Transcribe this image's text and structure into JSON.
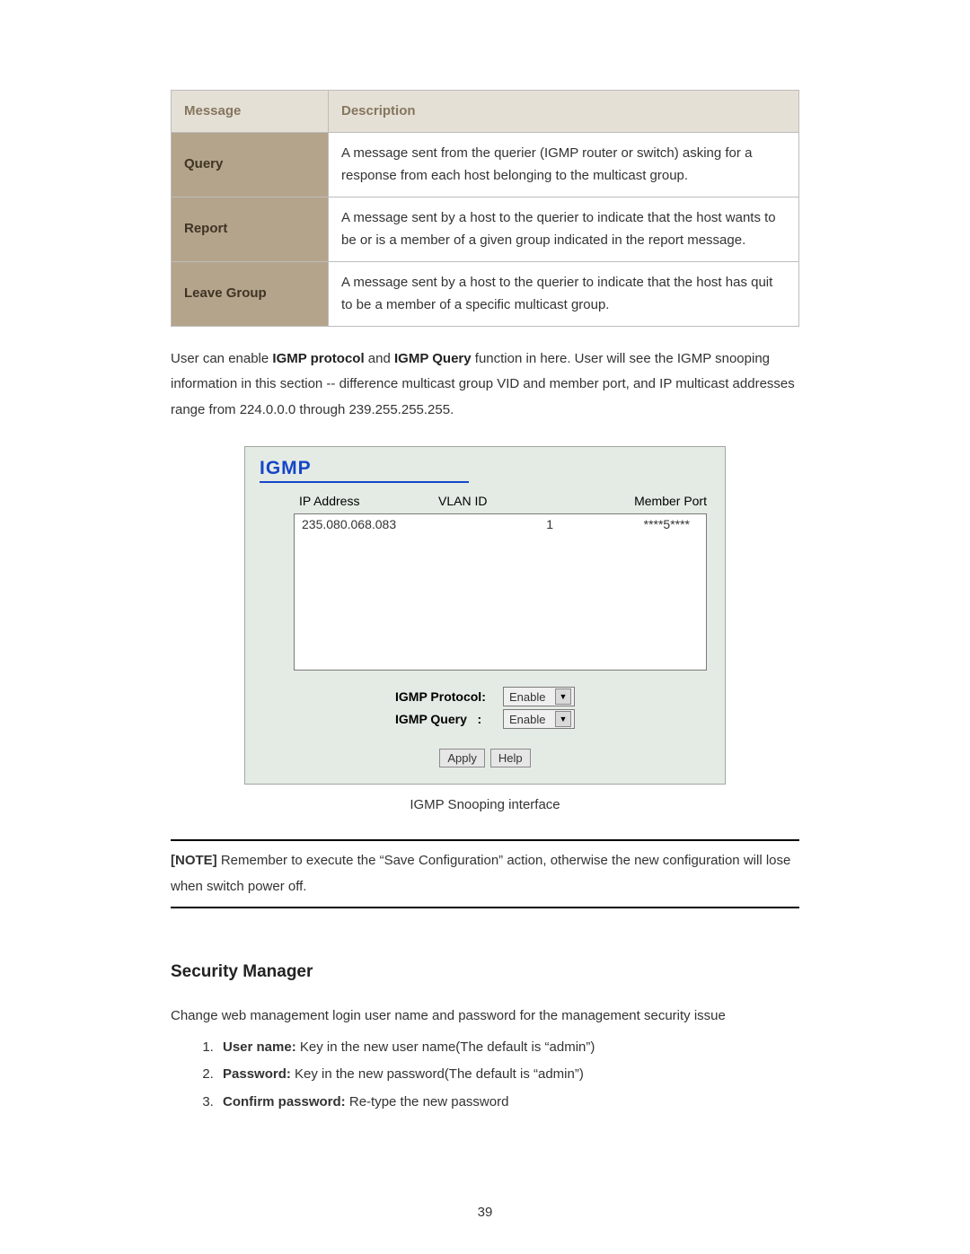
{
  "table": {
    "header_message": "Message",
    "header_description": "Description",
    "rows": [
      {
        "label": "Query",
        "desc": "A message sent from the querier (IGMP router or switch) asking for a response from each host belonging to the multicast group."
      },
      {
        "label": "Report",
        "desc": "A message sent by a host to the querier to indicate that the host wants to be or is a member of a given group indicated in the report message."
      },
      {
        "label": "Leave Group",
        "desc": "A message sent by a host to the querier to indicate that the host has quit to be a member of a specific multicast group."
      }
    ]
  },
  "paragraph": {
    "p1_prefix": "User can enable ",
    "p1_b1": "IGMP protocol",
    "p1_mid": " and ",
    "p1_b2": "IGMP Query",
    "p1_suffix": " function in here. User will see the IGMP snooping information in this section -- difference multicast group VID and member port, and IP multicast addresses range from 224.0.0.0 through 239.255.255.255."
  },
  "igmp": {
    "title": "IGMP",
    "hdr_ip": "IP Address",
    "hdr_vlan": "VLAN ID",
    "hdr_port": "Member Port",
    "row_ip": "235.080.068.083",
    "row_vlan": "1",
    "row_port": "****5****",
    "lbl_protocol": "IGMP Protocol:",
    "lbl_query": "IGMP Query   :",
    "sel_protocol": "Enable",
    "sel_query": "Enable",
    "btn_apply": "Apply",
    "btn_help": "Help"
  },
  "caption": "IGMP Snooping interface",
  "note": {
    "bold": "[NOTE]",
    "text": " Remember to execute the “Save Configuration” action, otherwise the new configuration will lose when switch power off."
  },
  "security": {
    "heading": "Security Manager",
    "intro": "Change web management login user name and password for the management security issue",
    "items": [
      {
        "bold": "User name:",
        "rest": " Key in the new user name(The default is “admin”)"
      },
      {
        "bold": "Password:",
        "rest": " Key in the new password(The default is “admin”)"
      },
      {
        "bold": "Confirm password:",
        "rest": " Re-type the new password"
      }
    ]
  },
  "page_number": "39"
}
